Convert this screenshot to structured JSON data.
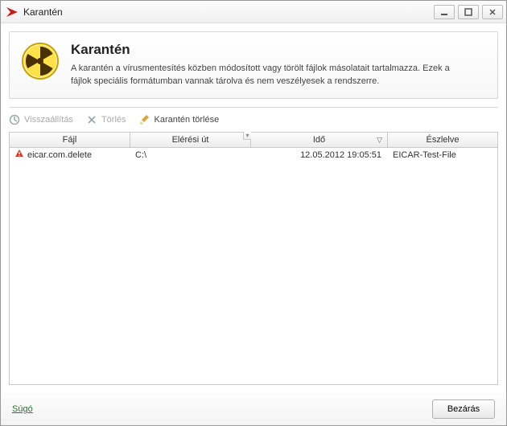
{
  "window": {
    "title": "Karantén"
  },
  "header": {
    "title": "Karantén",
    "description": "A karantén a vírusmentesítés közben módosított vagy törölt fájlok másolatait tartalmazza. Ezek a fájlok speciális formátumban vannak tárolva és nem veszélyesek a rendszerre."
  },
  "toolbar": {
    "restore": "Visszaállítás",
    "delete": "Törlés",
    "clear": "Karantén törlése"
  },
  "columns": {
    "file": "Fájl",
    "path": "Elérési út",
    "time": "Idő",
    "detected": "Észlelve"
  },
  "rows": [
    {
      "file": "eicar.com.delete",
      "path": "C:\\",
      "time": "12.05.2012 19:05:51",
      "detected": "EICAR-Test-File"
    }
  ],
  "footer": {
    "help": "Súgó",
    "close": "Bezárás"
  }
}
